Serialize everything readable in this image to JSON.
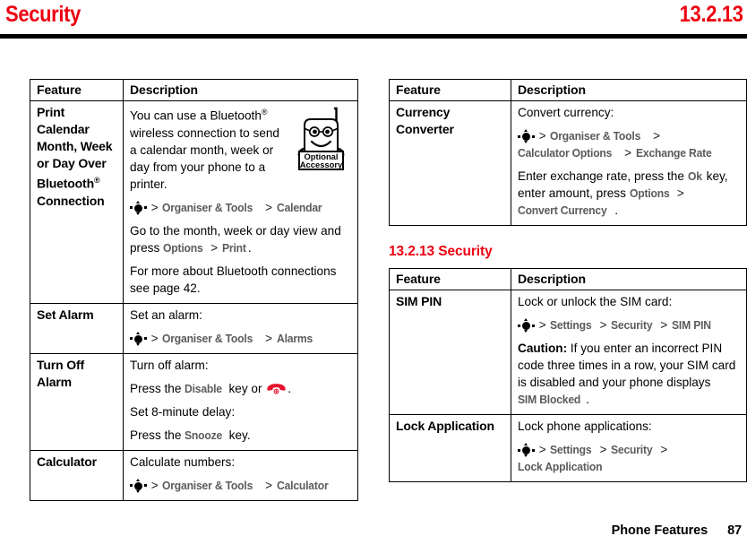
{
  "header": {
    "title": "Security",
    "section_number": "13.2.13",
    "accent_color": "#ee0011"
  },
  "footer": {
    "label": "Phone Features",
    "page_number": "87"
  },
  "icons": {
    "nav_key": "nav-key-icon",
    "end_call_key": "end-call-key-icon",
    "optional_accessory": "optional-accessory-icon"
  },
  "accessory_badge": {
    "line1": "Optional",
    "line2": "Accessory"
  },
  "left_column": {
    "table": {
      "headers": [
        "Feature",
        "Description"
      ],
      "rows": [
        {
          "feature_parts": [
            {
              "text": "Print Calendar Month, Week or Day Over Bluetooth",
              "style": "plain"
            },
            {
              "text": "®",
              "style": "sup"
            },
            {
              "text": " Connection",
              "style": "plain"
            }
          ],
          "feature_plain": "Print Calendar Month, Week or Day Over Bluetooth® Connection",
          "has_accessory_art": true,
          "blocks": [
            {
              "type": "text",
              "parts": [
                {
                  "text": "You can use a Bluetooth",
                  "style": "plain"
                },
                {
                  "text": "®",
                  "style": "sup"
                },
                {
                  "text": " wireless connection to send a calendar month, week or day from your phone to a printer.",
                  "style": "plain"
                }
              ]
            },
            {
              "type": "text",
              "parts": [
                {
                  "text": "",
                  "style": "navkey"
                },
                {
                  "text": " > ",
                  "style": "sep"
                },
                {
                  "text": "Organiser & Tools",
                  "style": "path"
                },
                {
                  "text": " > ",
                  "style": "sep"
                },
                {
                  "text": "Calendar",
                  "style": "path"
                }
              ]
            },
            {
              "type": "text",
              "parts": [
                {
                  "text": "Go to the month, week or day view and press ",
                  "style": "plain"
                },
                {
                  "text": "Options",
                  "style": "path"
                },
                {
                  "text": " > ",
                  "style": "sep"
                },
                {
                  "text": "Print",
                  "style": "path"
                },
                {
                  "text": ".",
                  "style": "plain"
                }
              ]
            },
            {
              "type": "text",
              "parts": [
                {
                  "text": "For more about Bluetooth connections see page 42.",
                  "style": "plain"
                }
              ]
            }
          ]
        },
        {
          "feature_parts": [
            {
              "text": "Set Alarm",
              "style": "plain"
            }
          ],
          "feature_plain": "Set Alarm",
          "has_accessory_art": false,
          "blocks": [
            {
              "type": "text",
              "parts": [
                {
                  "text": "Set an alarm:",
                  "style": "plain"
                }
              ]
            },
            {
              "type": "text",
              "parts": [
                {
                  "text": "",
                  "style": "navkey"
                },
                {
                  "text": " > ",
                  "style": "sep"
                },
                {
                  "text": "Organiser & Tools",
                  "style": "path"
                },
                {
                  "text": " > ",
                  "style": "sep"
                },
                {
                  "text": "Alarms",
                  "style": "path"
                }
              ]
            }
          ]
        },
        {
          "feature_parts": [
            {
              "text": "Turn Off Alarm",
              "style": "plain"
            }
          ],
          "feature_plain": "Turn Off Alarm",
          "has_accessory_art": false,
          "blocks": [
            {
              "type": "text",
              "parts": [
                {
                  "text": "Turn off alarm:",
                  "style": "plain"
                }
              ]
            },
            {
              "type": "text",
              "parts": [
                {
                  "text": "Press the ",
                  "style": "plain"
                },
                {
                  "text": "Disable",
                  "style": "path"
                },
                {
                  "text": " key or ",
                  "style": "plain"
                },
                {
                  "text": "",
                  "style": "endkey"
                },
                {
                  "text": ".",
                  "style": "plain"
                }
              ]
            },
            {
              "type": "text",
              "parts": [
                {
                  "text": "Set 8-minute delay:",
                  "style": "plain"
                }
              ]
            },
            {
              "type": "text",
              "parts": [
                {
                  "text": "Press the ",
                  "style": "plain"
                },
                {
                  "text": "Snooze",
                  "style": "path"
                },
                {
                  "text": " key.",
                  "style": "plain"
                }
              ]
            }
          ]
        },
        {
          "feature_parts": [
            {
              "text": "Calculator",
              "style": "plain"
            }
          ],
          "feature_plain": "Calculator",
          "has_accessory_art": false,
          "blocks": [
            {
              "type": "text",
              "parts": [
                {
                  "text": "Calculate numbers:",
                  "style": "plain"
                }
              ]
            },
            {
              "type": "text",
              "parts": [
                {
                  "text": "",
                  "style": "navkey"
                },
                {
                  "text": " > ",
                  "style": "sep"
                },
                {
                  "text": "Organiser & Tools",
                  "style": "path"
                },
                {
                  "text": " > ",
                  "style": "sep"
                },
                {
                  "text": "Calculator",
                  "style": "path"
                }
              ]
            }
          ]
        }
      ]
    }
  },
  "right_column": {
    "table_top": {
      "headers": [
        "Feature",
        "Description"
      ],
      "rows": [
        {
          "feature_parts": [
            {
              "text": "Currency Converter",
              "style": "plain"
            }
          ],
          "feature_plain": "Currency Converter",
          "has_accessory_art": false,
          "blocks": [
            {
              "type": "text",
              "parts": [
                {
                  "text": "Convert currency:",
                  "style": "plain"
                }
              ]
            },
            {
              "type": "text",
              "parts": [
                {
                  "text": "",
                  "style": "navkey"
                },
                {
                  "text": " > ",
                  "style": "sep"
                },
                {
                  "text": "Organiser & Tools",
                  "style": "path"
                },
                {
                  "text": " > ",
                  "style": "sep"
                },
                {
                  "text": "Calculator Options",
                  "style": "path"
                },
                {
                  "text": " > ",
                  "style": "sep"
                },
                {
                  "text": "Exchange Rate",
                  "style": "path"
                }
              ]
            },
            {
              "type": "text",
              "parts": [
                {
                  "text": "Enter exchange rate, press the ",
                  "style": "plain"
                },
                {
                  "text": "Ok",
                  "style": "path"
                },
                {
                  "text": " key, enter amount, press ",
                  "style": "plain"
                },
                {
                  "text": "Options",
                  "style": "path"
                },
                {
                  "text": " > ",
                  "style": "sep"
                },
                {
                  "text": "Convert Currency",
                  "style": "path"
                },
                {
                  "text": ".",
                  "style": "plain"
                }
              ]
            }
          ]
        }
      ]
    },
    "section_heading": "13.2.13 Security",
    "table_bottom": {
      "headers": [
        "Feature",
        "Description"
      ],
      "rows": [
        {
          "feature_parts": [
            {
              "text": "SIM PIN",
              "style": "plain"
            }
          ],
          "feature_plain": "SIM PIN",
          "has_accessory_art": false,
          "blocks": [
            {
              "type": "text",
              "parts": [
                {
                  "text": "Lock or unlock the SIM card:",
                  "style": "plain"
                }
              ]
            },
            {
              "type": "text",
              "parts": [
                {
                  "text": "",
                  "style": "navkey"
                },
                {
                  "text": " > ",
                  "style": "sep"
                },
                {
                  "text": "Settings",
                  "style": "path"
                },
                {
                  "text": " > ",
                  "style": "sep"
                },
                {
                  "text": "Security",
                  "style": "path"
                },
                {
                  "text": " > ",
                  "style": "sep"
                },
                {
                  "text": "SIM PIN",
                  "style": "path"
                }
              ]
            },
            {
              "type": "text",
              "parts": [
                {
                  "text": "Caution:",
                  "style": "caution"
                },
                {
                  "text": " If you enter an incorrect PIN code three times in a row, your SIM card is disabled and your phone displays ",
                  "style": "plain"
                },
                {
                  "text": "SIM Blocked",
                  "style": "path"
                },
                {
                  "text": ".",
                  "style": "plain"
                }
              ]
            }
          ]
        },
        {
          "feature_parts": [
            {
              "text": "Lock Application",
              "style": "plain"
            }
          ],
          "feature_plain": "Lock Application",
          "has_accessory_art": false,
          "blocks": [
            {
              "type": "text",
              "parts": [
                {
                  "text": "Lock phone applications:",
                  "style": "plain"
                }
              ]
            },
            {
              "type": "text",
              "parts": [
                {
                  "text": "",
                  "style": "navkey"
                },
                {
                  "text": " > ",
                  "style": "sep"
                },
                {
                  "text": "Settings",
                  "style": "path"
                },
                {
                  "text": " > ",
                  "style": "sep"
                },
                {
                  "text": "Security",
                  "style": "path"
                },
                {
                  "text": " > ",
                  "style": "sep"
                },
                {
                  "text": "Lock Application",
                  "style": "path"
                }
              ]
            }
          ]
        }
      ]
    }
  }
}
